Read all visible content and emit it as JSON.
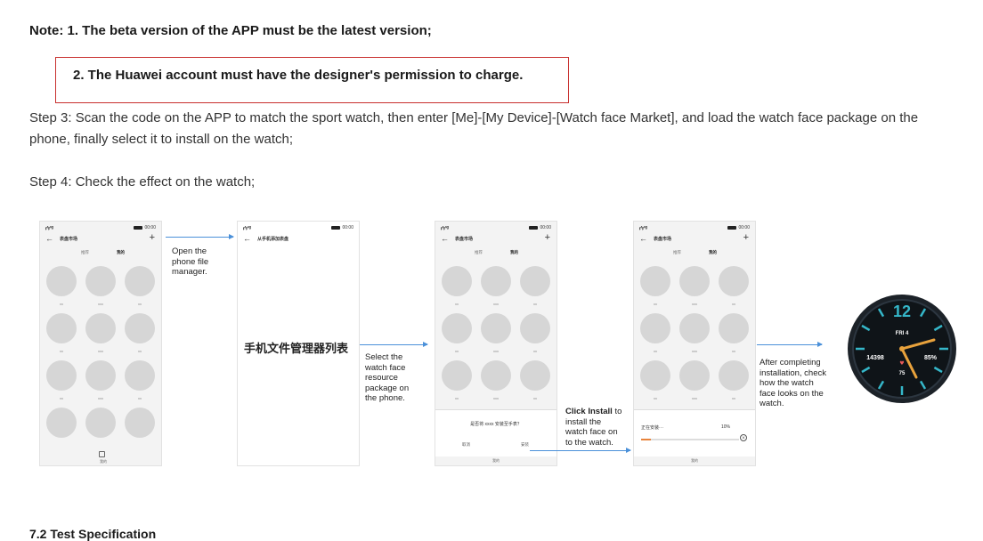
{
  "doc": {
    "note1": "Note: 1. The beta version of the APP must be the latest version;",
    "note2": "2. The Huawei account must have the designer's permission to charge.",
    "step3": "Step 3: Scan the code on the APP to match the sport watch, then enter [Me]-[My Device]-[Watch face Market], and load the watch face package on the phone, finally select it to install on the watch;",
    "step4": "Step 4: Check the effect on the watch;",
    "section": "7.2 Test Specification"
  },
  "flow": {
    "phone1": {
      "status_left": "ᵢₗ⁴ᵢₗ⁴ᵍ",
      "time": "00:00",
      "title": "表盘市场",
      "tab1": "推荐",
      "tab2": "我的",
      "nav_label": "我的",
      "labels": [
        "xx",
        "xxx",
        "xx",
        "xx",
        "xxx",
        "xx",
        "xx",
        "xxx",
        "xx"
      ]
    },
    "caption1": "Open the phone file manager.",
    "phone2": {
      "status_left": "ᵢₗ⁴ᵢₗ⁴ᵍ",
      "time": "00:00",
      "title": "从手机添加表盘",
      "big_text": "手机文件管理器列表"
    },
    "caption2": "Select the watch face resource package on the phone.",
    "phone3": {
      "status_left": "ᵢₗ⁴ᵢₗ⁴ᵍ",
      "time": "00:00",
      "title": "表盘市场",
      "tab1": "推荐",
      "tab2": "我的",
      "dialog_text": "是否将 xxxx 安装至手表？",
      "cancel": "取消",
      "ok": "安装",
      "nav_label": "我的",
      "labels": [
        "xx",
        "xxx",
        "xx",
        "xx",
        "xxx",
        "xx",
        "xx",
        "xxx",
        "xx"
      ]
    },
    "caption3_bold": "Click Install",
    "caption3_rest": "to install the watch face on to the watch.",
    "phone4": {
      "status_left": "ᵢₗ⁴ᵢₗ⁴ᵍ",
      "time": "00:00",
      "title": "表盘市场",
      "tab1": "推荐",
      "tab2": "我的",
      "installing": "正在安装···",
      "percent": "10%",
      "progress": 0.1,
      "nav_label": "我的",
      "labels": [
        "xx",
        "xxx",
        "xx",
        "xx",
        "xxx",
        "xx",
        "xx",
        "xxx",
        "xx"
      ]
    },
    "caption4": "After completing installation, check how the watch face looks on the watch.",
    "watch": {
      "hour": "12",
      "day": "FRI 4",
      "steps": "14398",
      "battery": "85%",
      "heart": "75",
      "accent": "#35b7c9",
      "hand_color": "#e8a23c"
    }
  }
}
